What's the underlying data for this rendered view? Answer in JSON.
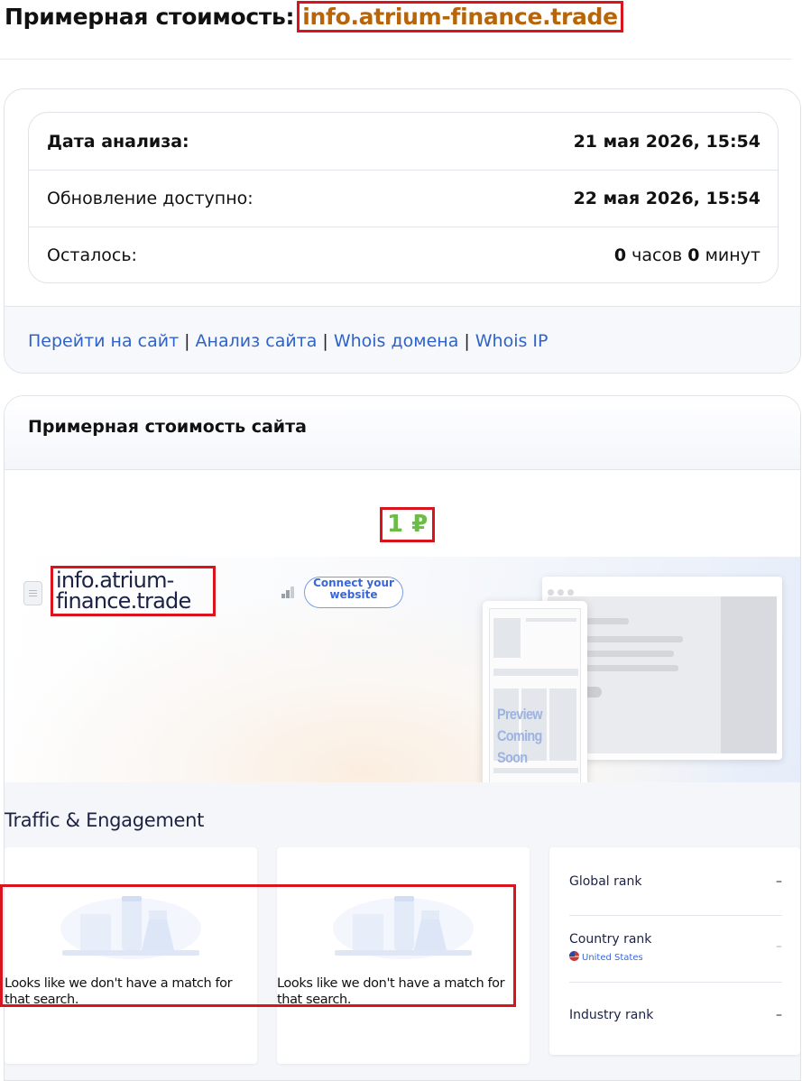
{
  "header": {
    "title_prefix": "Примерная стоимость:",
    "domain": "info.atrium-finance.trade"
  },
  "info_table": {
    "rows": [
      {
        "label": "Дата анализа:",
        "value": "21 мая 2026, 15:54"
      },
      {
        "label": "Обновление доступно:",
        "value": "22 мая 2026, 15:54"
      },
      {
        "label": "Осталось:",
        "hours": "0",
        "hours_unit": "часов",
        "minutes": "0",
        "minutes_unit": "минут"
      }
    ]
  },
  "links": {
    "goto_site": "Перейти на сайт",
    "site_analysis": "Анализ сайта",
    "whois_domain": "Whois домена",
    "whois_ip": "Whois IP",
    "separator": "|"
  },
  "estimate": {
    "heading": "Примерная стоимость сайта",
    "price": "1 ₽",
    "price_color": "#6cbc4a"
  },
  "preview": {
    "site_name_line1": "info.atrium-",
    "site_name_line2": "finance.trade",
    "connect_button": "Connect your website",
    "placeholder_line1": "Preview",
    "placeholder_line2": "Coming Soon"
  },
  "traffic": {
    "title": "Traffic & Engagement",
    "no_match_text": "Looks like we don't have a match for that search.",
    "ranks": [
      {
        "label": "Global rank",
        "value": "–"
      },
      {
        "label": "Country rank",
        "sub": "United States",
        "value": "–"
      },
      {
        "label": "Industry rank",
        "value": "–"
      }
    ]
  },
  "colors": {
    "domain_highlight": "#b8650a",
    "link": "#2f63c9",
    "annotation_box": "#d9141c"
  }
}
